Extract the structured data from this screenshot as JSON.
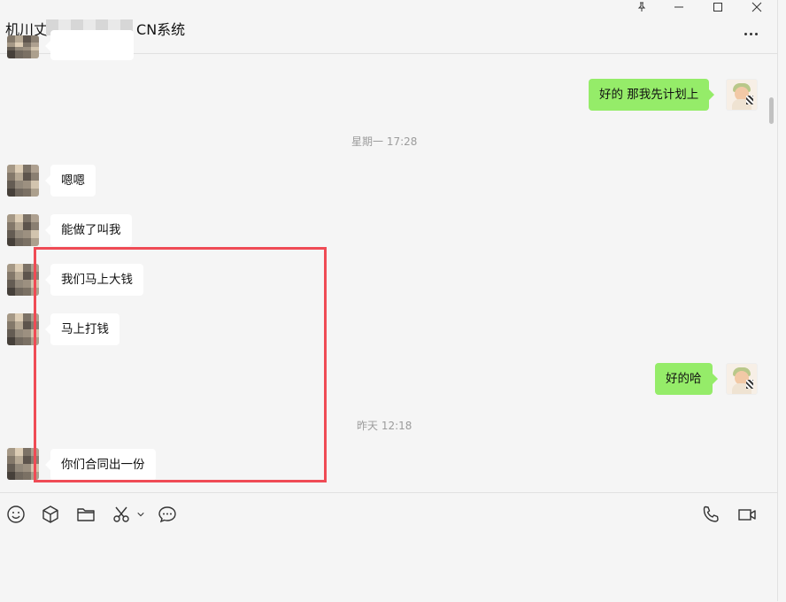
{
  "window": {
    "title_visible": "CN系统",
    "title_prefix_fragment": "机川丈",
    "controls": [
      "pin",
      "minimize",
      "maximize",
      "close"
    ]
  },
  "messages": [
    {
      "side": "in",
      "text": ""
    },
    {
      "side": "out",
      "text": "好的 那我先计划上"
    },
    {
      "type": "time",
      "text": "星期一 17:28"
    },
    {
      "side": "in",
      "text": "嗯嗯"
    },
    {
      "side": "in",
      "text": "能做了叫我"
    },
    {
      "side": "in",
      "text": "我们马上大钱"
    },
    {
      "side": "in",
      "text": "马上打钱"
    },
    {
      "side": "out",
      "text": "好的哈"
    },
    {
      "type": "time",
      "text": "昨天 12:18"
    },
    {
      "side": "in",
      "text": "你们合同出一份"
    }
  ],
  "toolbar": {
    "left": [
      "emoji-icon",
      "cube-icon",
      "folder-icon",
      "scissors-icon",
      "chevron-down-icon",
      "chat-bubble-icon"
    ],
    "right": [
      "phone-icon",
      "video-icon"
    ]
  },
  "colors": {
    "background": "#f5f5f5",
    "bubble_in": "#ffffff",
    "bubble_out": "#95ec69",
    "highlight_box": "#ef4b55"
  }
}
